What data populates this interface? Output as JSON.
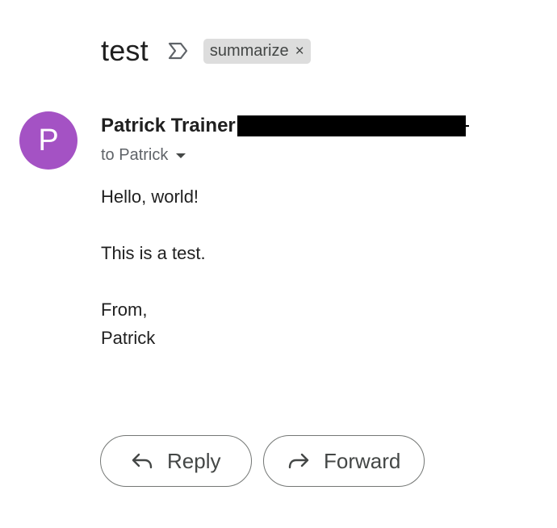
{
  "email": {
    "subject": "test",
    "label_chip": {
      "text": "summarize",
      "remove_glyph": "×"
    },
    "sender": {
      "avatar_letter": "P",
      "avatar_color": "#a452c4",
      "name": "Patrick Trainer"
    },
    "recipient_line": "to Patrick",
    "body": {
      "greeting": "Hello, world!",
      "line": "This is a test.",
      "closing_1": "From,",
      "closing_2": "Patrick"
    }
  },
  "actions": {
    "reply_label": "Reply",
    "forward_label": "Forward"
  },
  "icons": {
    "importance": "importance-marker-icon",
    "reply": "reply-arrow-icon",
    "forward": "forward-arrow-icon",
    "details": "chevron-down-icon"
  }
}
